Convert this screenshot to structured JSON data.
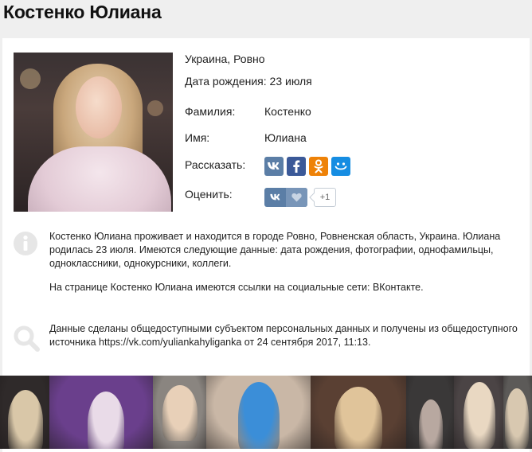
{
  "page": {
    "title": "Костенко Юлиана"
  },
  "profile": {
    "location": "Украина, Ровно",
    "birthday": "Дата рождения: 23 июля",
    "surname_label": "Фамилия:",
    "surname_value": "Костенко",
    "name_label": "Имя:",
    "name_value": "Юлиана",
    "share_label": "Рассказать:",
    "rate_label": "Оценить:",
    "like_count": "+1"
  },
  "share_buttons": [
    {
      "name": "vk",
      "glyph": "vk",
      "color": "#5b7ea6"
    },
    {
      "name": "facebook",
      "glyph": "f",
      "color": "#3b5998"
    },
    {
      "name": "odnoklassniki",
      "glyph": "ok",
      "color": "#ee8208"
    },
    {
      "name": "moimir",
      "glyph": "smile",
      "color": "#168de2"
    }
  ],
  "info": {
    "about": "Костенко Юлиана проживает и находится в городе Ровно, Ровненская область, Украина. Юлиана родилась 23 июля. Имеются следующие данные: дата рождения, фотографии, однофамильцы, одноклассники, однокурсники, коллеги.",
    "links": "На странице Костенко Юлиана имеются ссылки на социальные сети: ВКонтакте.",
    "source": "Данные сделаны общедоступными субъектом персональных данных и получены из общедоступного источника https://vk.com/yuliankahyliganka от 24 сентября 2017, 11:13."
  },
  "icons": {
    "info": "info-circle-icon",
    "search": "magnifier-icon",
    "icon_color": "#e6e6e6"
  },
  "gallery": [
    {
      "bg": "#2f2a2a",
      "fig": "#d9c7a8"
    },
    {
      "bg": "#6a3f8c",
      "fig": "#e9dbe8"
    },
    {
      "bg": "#8a8580",
      "fig": "#e8d0b8"
    },
    {
      "bg": "#c9b7a6",
      "fig": "#3b8ed8"
    },
    {
      "bg": "#5a4033",
      "fig": "#e0c49a"
    },
    {
      "bg": "#3a3838",
      "fig": "#b8a8a0"
    },
    {
      "bg": "#4b4445",
      "fig": "#e9d8c2"
    },
    {
      "bg": "#5c5a58",
      "fig": "#d8c8b0"
    }
  ]
}
